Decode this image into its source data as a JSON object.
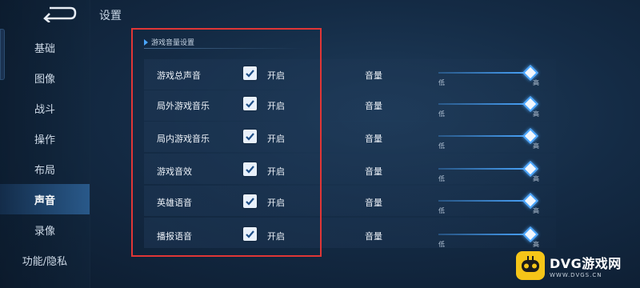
{
  "page_title": "设置",
  "sidebar": {
    "items": [
      {
        "label": "基础",
        "active": false
      },
      {
        "label": "图像",
        "active": false
      },
      {
        "label": "战斗",
        "active": false
      },
      {
        "label": "操作",
        "active": false
      },
      {
        "label": "布局",
        "active": false
      },
      {
        "label": "声音",
        "active": true
      },
      {
        "label": "录像",
        "active": false
      },
      {
        "label": "功能/隐私",
        "active": false
      }
    ]
  },
  "section": {
    "title": "游戏音量设置"
  },
  "rows": [
    {
      "label": "游戏总声音",
      "enabled": true,
      "toggle_label": "开启",
      "volume_label": "音量",
      "min_label": "低",
      "max_label": "高",
      "level": 1.0
    },
    {
      "label": "局外游戏音乐",
      "enabled": true,
      "toggle_label": "开启",
      "volume_label": "音量",
      "min_label": "低",
      "max_label": "高",
      "level": 1.0
    },
    {
      "label": "局内游戏音乐",
      "enabled": true,
      "toggle_label": "开启",
      "volume_label": "音量",
      "min_label": "低",
      "max_label": "高",
      "level": 1.0
    },
    {
      "label": "游戏音效",
      "enabled": true,
      "toggle_label": "开启",
      "volume_label": "音量",
      "min_label": "低",
      "max_label": "高",
      "level": 1.0
    },
    {
      "label": "英雄语音",
      "enabled": true,
      "toggle_label": "开启",
      "volume_label": "音量",
      "min_label": "低",
      "max_label": "高",
      "level": 1.0
    },
    {
      "label": "播报语音",
      "enabled": true,
      "toggle_label": "开启",
      "volume_label": "音量",
      "min_label": "低",
      "max_label": "高",
      "level": 1.0
    }
  ],
  "watermark": {
    "brand": "DVG游戏网",
    "url": "WWW.DVGS.CN"
  },
  "colors": {
    "accent": "#4aa6ff",
    "highlight": "#e03636",
    "logo": "#f5c518"
  }
}
